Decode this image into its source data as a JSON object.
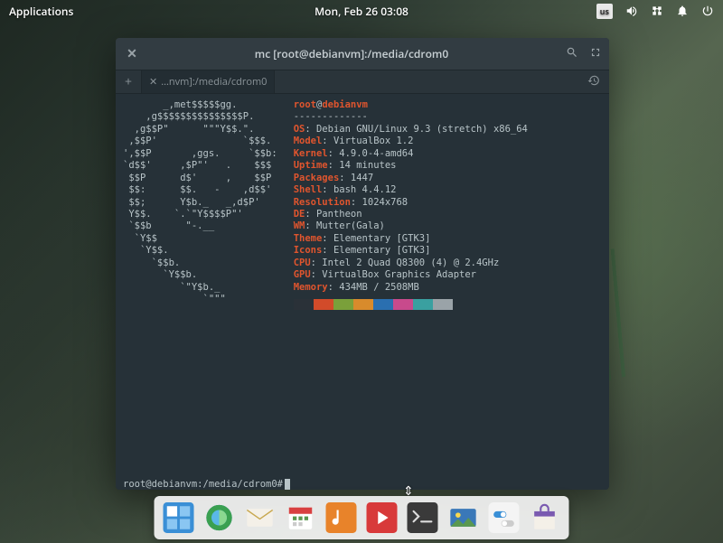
{
  "topbar": {
    "applications": "Applications",
    "clock": "Mon, Feb 26   03:08",
    "kbd": "us"
  },
  "terminal": {
    "title": "mc [root@debianvm]:/media/cdrom0",
    "tab_label": "...nvm]:/media/cdrom0",
    "user": "root",
    "host": "debianvm",
    "info": {
      "OS": "Debian GNU/Linux 9.3 (stretch) x86_64",
      "Model": "VirtualBox 1.2",
      "Kernel": "4.9.0-4-amd64",
      "Uptime": "14 minutes",
      "Packages": "1447",
      "Shell": "bash 4.4.12",
      "Resolution": "1024x768",
      "DE": "Pantheon",
      "WM": "Mutter(Gala)",
      "Theme": "Elementary [GTK3]",
      "Icons": "Elementary [GTK3]",
      "CPU": "Intel 2 Quad Q8300 (4) @ 2.4GHz",
      "GPU": "VirtualBox Graphics Adapter",
      "Memory": "434MB / 2508MB"
    },
    "swatches": [
      "#2a3138",
      "#d24b2a",
      "#7aa03a",
      "#d88b2c",
      "#2a6fb0",
      "#c84a8c",
      "#3aa0a0",
      "#9aa3a8"
    ],
    "prompt": "root@debianvm:/media/cdrom0#",
    "ascii": "       _,met$$$$$gg.\n    ,g$$$$$$$$$$$$$$$P.\n  ,g$$P\"      \"\"\"Y$$.\".\n ,$$P'               `$$$.\n',$$P       ,ggs.     `$$b:\n`d$$'     ,$P\"'   .    $$$\n $$P      d$'     ,    $$P\n $$:      $$.   -    ,d$$'\n $$;      Y$b._   _,d$P'\n Y$$.    `.`\"Y$$$$P\"'\n `$$b      \"-.__\n  `Y$$\n   `Y$$.\n     `$$b.\n       `Y$$b.\n          `\"Y$b._\n              `\"\"\""
  },
  "dock": {
    "items": [
      "multitasking",
      "web-browser",
      "mail",
      "calendar",
      "music",
      "videos",
      "terminal",
      "photos",
      "system-settings",
      "software-center"
    ]
  }
}
